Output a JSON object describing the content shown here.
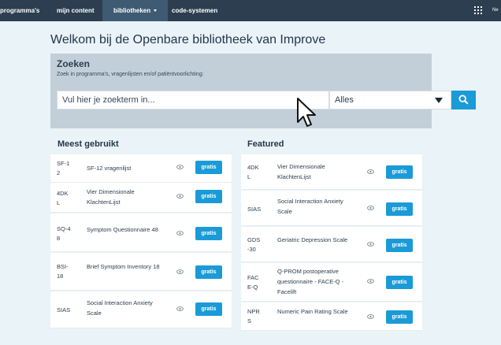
{
  "nav": {
    "items": [
      {
        "label": "programma's"
      },
      {
        "label": "mijn content"
      },
      {
        "label": "bibliotheken"
      },
      {
        "label": "code-systemen"
      }
    ],
    "user": "Ne"
  },
  "page": {
    "title": "Welkom bij de Openbare bibliotheek van Improve"
  },
  "search": {
    "title": "Zoeken",
    "subtitle": "Zoek in programma's, vragenlijsten en/of patiëntvoorlichting:",
    "placeholder": "Vul hier je zoekterm in...",
    "filter_value": "Alles"
  },
  "most_used": {
    "title": "Meest gebruikt",
    "items": [
      {
        "code": "SF-1\n2",
        "name": "SF-12 vragenlijst",
        "price": "gratis"
      },
      {
        "code": "4DK\nL",
        "name": "Vier Dimensionale KlachtenLijst",
        "price": "gratis"
      },
      {
        "code": "SQ-4\n8",
        "name": "Symptom Questionnaire 48",
        "price": "gratis"
      },
      {
        "code": "BSI-\n18",
        "name": "Brief Symptom Inventory 18",
        "price": "gratis"
      },
      {
        "code": "SIAS",
        "name": "Social Interaction Anxiety Scale",
        "price": "gratis"
      }
    ]
  },
  "featured": {
    "title": "Featured",
    "items": [
      {
        "code": "4DK\nL",
        "name": "Vier Dimensionale KlachtenLijst",
        "price": "gratis"
      },
      {
        "code": "SIAS",
        "name": "Social Interaction Anxiety Scale",
        "price": "gratis"
      },
      {
        "code": "GDS\n-30",
        "name": "Geriatric Depression Scale",
        "price": "gratis"
      },
      {
        "code": "FAC\nE-Q",
        "name": "Q-PROM postoperative questionnaire - FACE-Q - Facelift",
        "price": "gratis"
      },
      {
        "code": "NPR\nS",
        "name": "Numeric Pain Rating Scale",
        "price": "gratis"
      }
    ]
  }
}
